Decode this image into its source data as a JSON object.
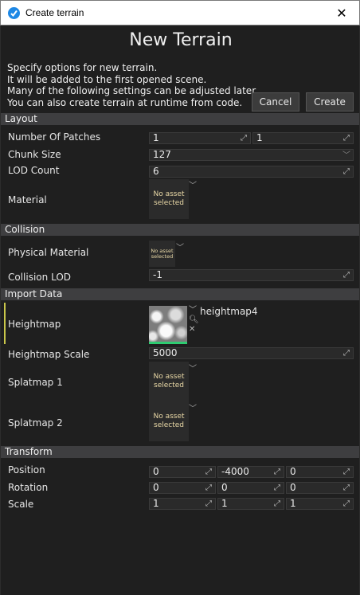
{
  "window": {
    "title": "Create terrain",
    "close_glyph": "✕"
  },
  "heading": "New Terrain",
  "description": [
    "Specify options for new terrain.",
    "It will be added to the first opened scene.",
    "Many of the following settings can be adjusted later.",
    "You can also create terrain at runtime from code."
  ],
  "buttons": {
    "cancel": "Cancel",
    "create": "Create"
  },
  "sections": {
    "layout": "Layout",
    "collision": "Collision",
    "import": "Import Data",
    "transform": "Transform"
  },
  "layout": {
    "patches_label": "Number Of Patches",
    "patches_x": "1",
    "patches_y": "1",
    "chunk_label": "Chunk Size",
    "chunk_value": "127",
    "lod_label": "LOD Count",
    "lod_value": "6",
    "material_label": "Material",
    "material_asset": "No asset selected"
  },
  "collision": {
    "phys_label": "Physical Material",
    "phys_asset": "No asset selected",
    "lod_label": "Collision LOD",
    "lod_value": "-1"
  },
  "import": {
    "heightmap_label": "Heightmap",
    "heightmap_name": "heightmap4",
    "scale_label": "Heightmap Scale",
    "scale_value": "5000",
    "splat1_label": "Splatmap 1",
    "splat1_asset": "No asset selected",
    "splat2_label": "Splatmap 2",
    "splat2_asset": "No asset selected"
  },
  "transform": {
    "position_label": "Position",
    "position": [
      "0",
      "-4000",
      "0"
    ],
    "rotation_label": "Rotation",
    "rotation": [
      "0",
      "0",
      "0"
    ],
    "scale_label": "Scale",
    "scale": [
      "1",
      "1",
      "1"
    ]
  },
  "icons": {
    "dropdown": "chevron-down-icon",
    "drag": "arrows-diagonal-icon",
    "search": "search-icon",
    "clear": "close-icon",
    "app": "flax-logo-icon"
  },
  "colors": {
    "accent": "#1e88e5",
    "heightmap_bar": "#2ecc71",
    "asset_text": "#e9d8a6",
    "section_bg": "#3e3e40"
  }
}
